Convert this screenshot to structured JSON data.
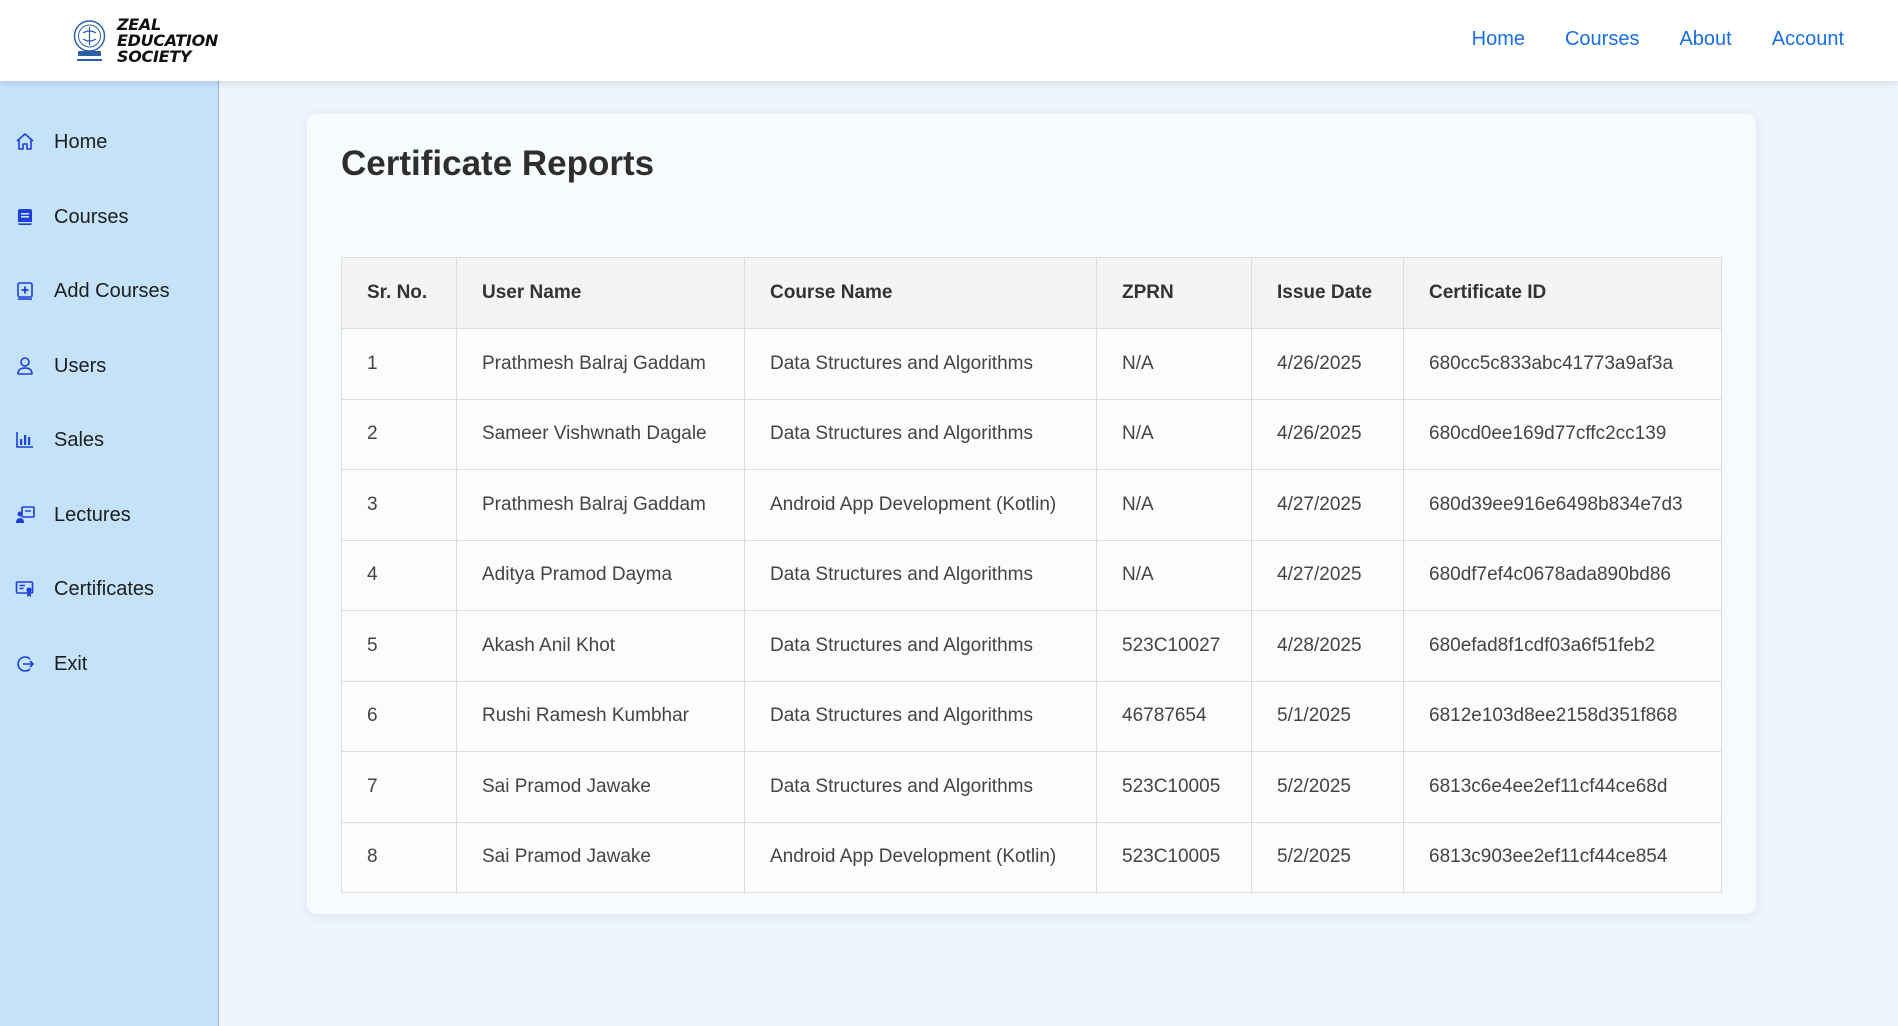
{
  "brand": {
    "line1": "ZEAL",
    "line2": "EDUCATION",
    "line3": "SOCIETY",
    "seal_icon": "zeal-seal-icon"
  },
  "topnav": [
    {
      "label": "Home"
    },
    {
      "label": "Courses"
    },
    {
      "label": "About"
    },
    {
      "label": "Account"
    }
  ],
  "sidebar": {
    "items": [
      {
        "label": "Home",
        "icon": "home-icon"
      },
      {
        "label": "Courses",
        "icon": "book-icon"
      },
      {
        "label": "Add Courses",
        "icon": "add-box-icon"
      },
      {
        "label": "Users",
        "icon": "user-icon"
      },
      {
        "label": "Sales",
        "icon": "bar-chart-icon"
      },
      {
        "label": "Lectures",
        "icon": "lecture-icon"
      },
      {
        "label": "Certificates",
        "icon": "certificate-icon"
      },
      {
        "label": "Exit",
        "icon": "exit-icon"
      }
    ]
  },
  "page": {
    "title": "Certificate Reports"
  },
  "table": {
    "headers": [
      "Sr. No.",
      "User Name",
      "Course Name",
      "ZPRN",
      "Issue Date",
      "Certificate ID"
    ],
    "rows": [
      [
        "1",
        "Prathmesh Balraj Gaddam",
        "Data Structures and Algorithms",
        "N/A",
        "4/26/2025",
        "680cc5c833abc41773a9af3a"
      ],
      [
        "2",
        "Sameer Vishwnath Dagale",
        "Data Structures and Algorithms",
        "N/A",
        "4/26/2025",
        "680cd0ee169d77cffc2cc139"
      ],
      [
        "3",
        "Prathmesh Balraj Gaddam",
        "Android App Development (Kotlin)",
        "N/A",
        "4/27/2025",
        "680d39ee916e6498b834e7d3"
      ],
      [
        "4",
        "Aditya Pramod Dayma",
        "Data Structures and Algorithms",
        "N/A",
        "4/27/2025",
        "680df7ef4c0678ada890bd86"
      ],
      [
        "5",
        "Akash Anil Khot",
        "Data Structures and Algorithms",
        "523C10027",
        "4/28/2025",
        "680efad8f1cdf03a6f51feb2"
      ],
      [
        "6",
        "Rushi Ramesh Kumbhar",
        "Data Structures and Algorithms",
        "46787654",
        "5/1/2025",
        "6812e103d8ee2158d351f868"
      ],
      [
        "7",
        "Sai Pramod Jawake",
        "Data Structures and Algorithms",
        "523C10005",
        "5/2/2025",
        "6813c6e4ee2ef11cf44ce68d"
      ],
      [
        "8",
        "Sai Pramod Jawake",
        "Android App Development (Kotlin)",
        "523C10005",
        "5/2/2025",
        "6813c903ee2ef11cf44ce854"
      ]
    ]
  },
  "colors": {
    "accent": "#1a6fe0",
    "sidebar_bg": "#c4e2fa",
    "icon": "#1e3fd8",
    "page_bg": "#eef5fe"
  }
}
